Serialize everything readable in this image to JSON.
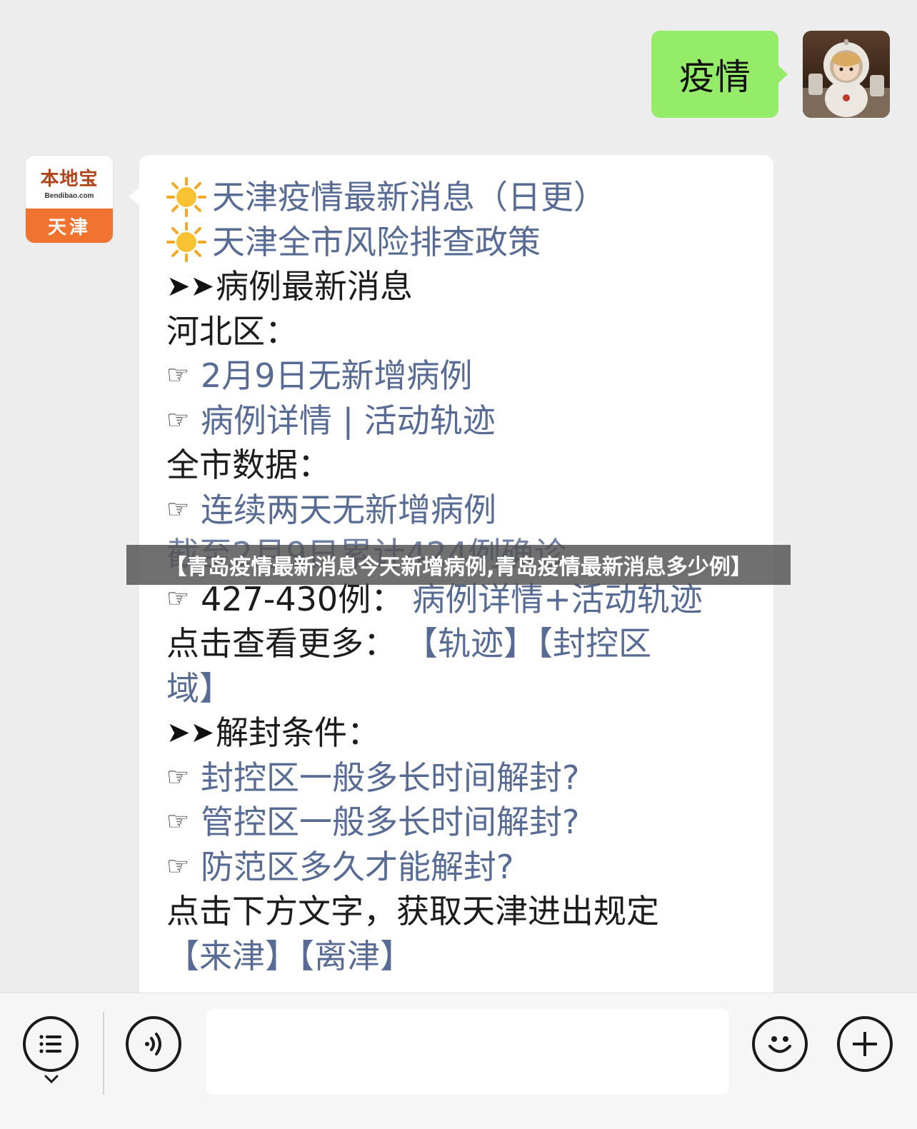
{
  "outgoing": {
    "text": "疫情"
  },
  "brand_avatar": {
    "name": "本地宝",
    "url": "Bendibao.com",
    "city": "天津"
  },
  "message": {
    "lines": [
      {
        "prefix": "sun",
        "text": "天津疫情最新消息（日更）",
        "style": "link"
      },
      {
        "prefix": "sun",
        "text": "天津全市风险排查政策",
        "style": "link"
      },
      {
        "prefix": "arrows",
        "arrows": "➤➤",
        "text": "病例最新消息",
        "style": "plain"
      },
      {
        "prefix": "none",
        "text": "河北区：",
        "style": "plain"
      },
      {
        "prefix": "hand",
        "hand": "☞",
        "text": "2月9日无新增病例",
        "style": "link"
      },
      {
        "prefix": "hand",
        "hand": "☞",
        "text": "病例详情 | 活动轨迹",
        "style": "link"
      },
      {
        "prefix": "none",
        "text": "全市数据：",
        "style": "plain"
      },
      {
        "prefix": "hand",
        "hand": "☞",
        "text": "连续两天无新增病例",
        "style": "link"
      },
      {
        "prefix": "none",
        "text": "截至2月9日累计424例确诊",
        "style": "partial"
      },
      {
        "prefix": "hand",
        "hand": "☞",
        "text": "427-430例：",
        "style": "plain",
        "link_text": "病例详情+活动轨迹"
      },
      {
        "prefix": "none",
        "text": "点击查看更多：",
        "style": "plain",
        "link_text": "【轨迹】【封控区"
      },
      {
        "prefix": "none",
        "text": "域】",
        "style": "link"
      },
      {
        "prefix": "arrows",
        "arrows": "➤➤",
        "text": "解封条件：",
        "style": "plain"
      },
      {
        "prefix": "hand",
        "hand": "☞",
        "text": "封控区一般多长时间解封?",
        "style": "link"
      },
      {
        "prefix": "hand",
        "hand": "☞",
        "text": "管控区一般多长时间解封?",
        "style": "link"
      },
      {
        "prefix": "hand",
        "hand": "☞",
        "text": "防范区多久才能解封?",
        "style": "link"
      },
      {
        "prefix": "none",
        "text": "点击下方文字，获取天津进出规定",
        "style": "plain"
      },
      {
        "prefix": "none",
        "text": "【来津】【离津】",
        "style": "link"
      }
    ]
  },
  "banner": {
    "text": "【青岛疫情最新消息今天新增病例,青岛疫情最新消息多少例】"
  },
  "input_bar": {
    "menu_icon": "menu-list-icon",
    "voice_icon": "voice-icon",
    "emoji_icon": "emoji-smile-icon",
    "plus_icon": "plus-icon",
    "placeholder": ""
  },
  "colors": {
    "link": "#576b95",
    "outgoing_bubble": "#95ec69",
    "brand_orange": "#f0742f",
    "background": "#ededed"
  }
}
